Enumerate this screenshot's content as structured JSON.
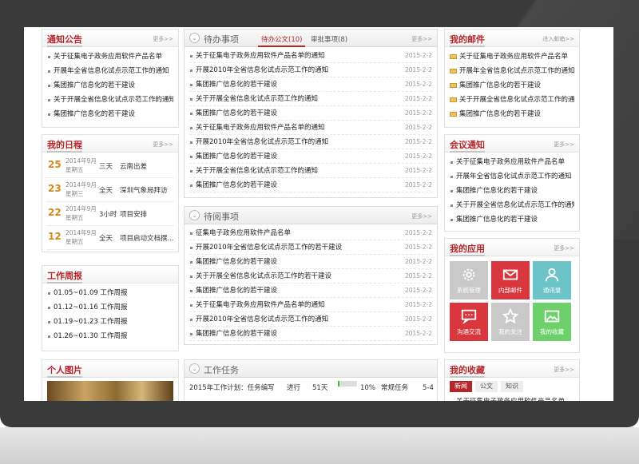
{
  "colors": {
    "accent": "#b5262b",
    "date_day": "#d08a1a",
    "progress": "#3cbf3c"
  },
  "notice": {
    "title": "通知公告",
    "more": "更多>>",
    "items": [
      "关于征集电子政务应用软件产品名单",
      "开展年全省信息化试点示范工作的通知",
      "集团推广信息化的若干建设",
      "关于开展全省信息化试点示范工作的通知",
      "集团推广信息化的若干建设"
    ]
  },
  "schedule": {
    "title": "我的日程",
    "more": "更多>>",
    "items": [
      {
        "day": "25",
        "ym": "2014年9月",
        "wd": "星期五",
        "dur": "三天",
        "text": "云南出差"
      },
      {
        "day": "23",
        "ym": "2014年9月",
        "wd": "星期三",
        "dur": "全天",
        "text": "深圳气象局拜访"
      },
      {
        "day": "22",
        "ym": "2014年9月",
        "wd": "星期五",
        "dur": "3小时",
        "text": "项目安排"
      },
      {
        "day": "12",
        "ym": "2014年9月",
        "wd": "星期五",
        "dur": "全天",
        "text": "项目启动文档撰..."
      }
    ]
  },
  "weekly": {
    "title": "工作周报",
    "items": [
      "01.05~01.09 工作周报",
      "01.12~01.16 工作周报",
      "01.19~01.23 工作周报",
      "01.26~01.30 工作周报"
    ]
  },
  "photos": {
    "title": "个人图片"
  },
  "todo": {
    "title": "待办事项",
    "more": "更多>>",
    "tab_active": "待办公文(10)",
    "tab_other": "审批事项(8)",
    "items": [
      {
        "text": "关于征集电子政务应用软件产品名单的通知",
        "date": "2015-2-2"
      },
      {
        "text": "开展2010年全省信息化试点示范工作的通知",
        "date": "2015-2-2"
      },
      {
        "text": "集团推广信息化的若干建设",
        "date": "2015-2-2"
      },
      {
        "text": "关于开展全省信息化试点示范工作的通知",
        "date": "2015-2-2"
      },
      {
        "text": "集团推广信息化的若干建设",
        "date": "2015-2-2"
      },
      {
        "text": "关于征集电子政务应用软件产品名单的通知",
        "date": "2015-2-2"
      },
      {
        "text": "开展2010年全省信息化试点示范工作的通知",
        "date": "2015-2-2"
      },
      {
        "text": "集团推广信息化的若干建设",
        "date": "2015-2-2"
      },
      {
        "text": "关于开展全省信息化试点示范工作的通知",
        "date": "2015-2-2"
      },
      {
        "text": "集团推广信息化的若干建设",
        "date": "2015-2-2"
      }
    ]
  },
  "toread": {
    "title": "待阅事项",
    "more": "更多>>",
    "items": [
      {
        "text": "征集电子政务应用软件产品名单",
        "date": "2015-2-2"
      },
      {
        "text": "开展2010年全省信息化试点示范工作的若干建设",
        "date": "2015-2-2"
      },
      {
        "text": "集团推广信息化的若干建设",
        "date": "2015-2-2"
      },
      {
        "text": "关于开展全省信息化试点示范工作的若干建设",
        "date": "2015-2-2"
      },
      {
        "text": "集团推广信息化的若干建设",
        "date": "2015-2-2"
      },
      {
        "text": "关于征集电子政务应用软件产品名单的通知",
        "date": "2015-2-2"
      },
      {
        "text": "开展2010年全省信息化试点示范工作的通知",
        "date": "2015-2-2"
      },
      {
        "text": "集团推广信息化的若干建设",
        "date": "2015-2-2"
      }
    ]
  },
  "tasks": {
    "title": "工作任务",
    "items": [
      {
        "name": "2015年工作计划：任务编写",
        "status": "进行",
        "days": "51天",
        "progress": 0.1,
        "pct": "10%",
        "type": "常规任务",
        "extra": "5-4"
      }
    ]
  },
  "mail": {
    "title": "我的邮件",
    "more": "进入邮箱>>",
    "items": [
      "关于征集电子政务应用软件产品名单",
      "开展年全省信息化试点示范工作的通知",
      "集团推广信息化的若干建设",
      "关于开展全省信息化试点示范工作的通知",
      "集团推广信息化的若干建设"
    ]
  },
  "meeting": {
    "title": "会议通知",
    "more": "更多>>",
    "items": [
      "关于征集电子政务应用软件产品名单",
      "开展年全省信息化试点示范工作的通知",
      "集团推广信息化的若干建设",
      "关于开展全省信息化试点示范工作的通知",
      "集团推广信息化的若干建设"
    ]
  },
  "apps": {
    "title": "我的应用",
    "more": "更多>>",
    "items": [
      {
        "label": "系统管理",
        "color": "#c9c9c9",
        "icon": "gear-icon"
      },
      {
        "label": "内部邮件",
        "color": "#d9363e",
        "icon": "mail-icon"
      },
      {
        "label": "通讯录",
        "color": "#6cc4c9",
        "icon": "contacts-icon"
      },
      {
        "label": "沟通交流",
        "color": "#d9363e",
        "icon": "chat-icon"
      },
      {
        "label": "我的关注",
        "color": "#c9c9c9",
        "icon": "star-icon"
      },
      {
        "label": "我的收藏",
        "color": "#6dd06a",
        "icon": "image-icon"
      }
    ]
  },
  "favorites": {
    "title": "我的收藏",
    "more": "更多>>",
    "tabs": [
      "新闻",
      "公文",
      "知识"
    ],
    "items": [
      "关于征集电子政务应用软件产品名单"
    ]
  }
}
